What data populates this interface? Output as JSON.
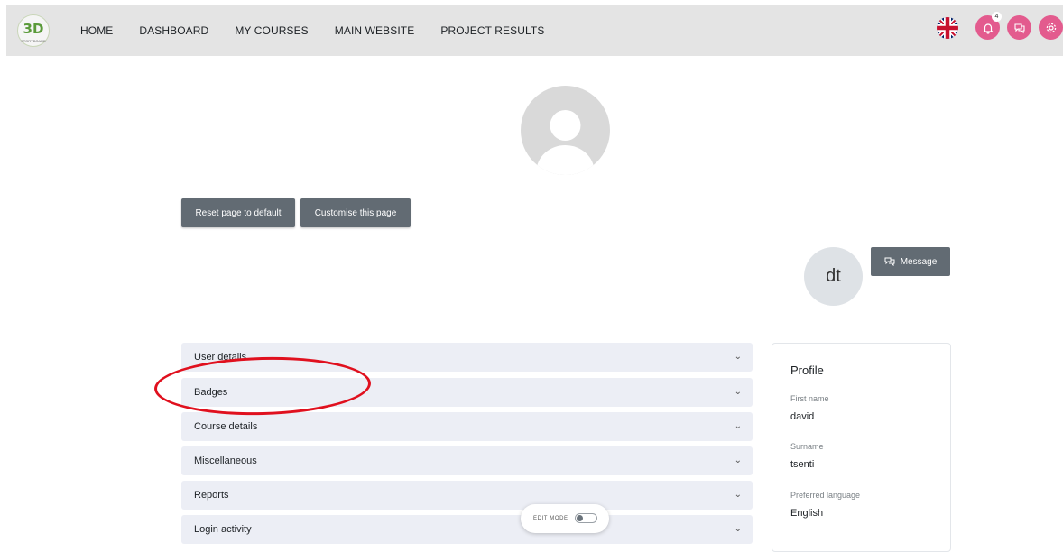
{
  "header": {
    "logo_text": "3D",
    "logo_subtext": "STORYBOARD",
    "nav": [
      "HOME",
      "DASHBOARD",
      "MY COURSES",
      "MAIN WEBSITE",
      "PROJECT RESULTS"
    ],
    "notification_count": "4",
    "accent_color": "#e35b8e"
  },
  "page": {
    "reset_button": "Reset page to default",
    "customise_button": "Customise this page"
  },
  "user": {
    "initials": "dt",
    "message_button": "Message"
  },
  "sections": [
    "User details",
    "Badges",
    "Course details",
    "Miscellaneous",
    "Reports",
    "Login activity"
  ],
  "profile": {
    "title": "Profile",
    "fields": [
      {
        "label": "First name",
        "value": "david"
      },
      {
        "label": "Surname",
        "value": "tsenti"
      },
      {
        "label": "Preferred language",
        "value": "English"
      }
    ]
  },
  "edit_mode": {
    "label": "EDIT MODE",
    "enabled": false
  }
}
